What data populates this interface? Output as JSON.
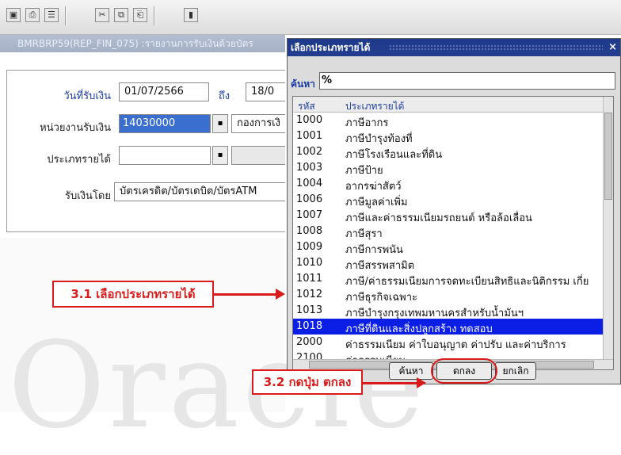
{
  "toolbar": {
    "icons": [
      "window-icon",
      "print-icon",
      "preview-icon",
      "cut-icon",
      "copy-icon",
      "paste-icon",
      "help-icon"
    ]
  },
  "bgwindow": {
    "title": "BMRBRP59(REP_FIN_075) :รายงานการรับเงินด้วยบัตร"
  },
  "form": {
    "date_label": "วันที่รับเงิน",
    "date_from": "01/07/2566",
    "to_label": "ถึง",
    "date_to": "18/0",
    "unit_label": "หน่วยงานรับเงิน",
    "unit_code": "14030000",
    "unit_name": "กองการเงิ",
    "income_label": "ประเภทรายได้",
    "income_value": "",
    "method_label": "รับเงินโดย",
    "method_value": "บัตรเครดิต/บัตรเดบิต/บัตรATM"
  },
  "watermark": "Oracle",
  "dialog": {
    "title": "เลือกประเภทรายได้",
    "close": "×",
    "search_label": "ค้นหา",
    "search_value": "%",
    "col_code": "รหัส",
    "col_name": "ประเภทรายได้",
    "rows": [
      {
        "code": "1000",
        "name": "ภาษีอากร"
      },
      {
        "code": "1001",
        "name": "ภาษีบำรุงท้องที่"
      },
      {
        "code": "1002",
        "name": "ภาษีโรงเรือนและที่ดิน"
      },
      {
        "code": "1003",
        "name": "ภาษีป้าย"
      },
      {
        "code": "1004",
        "name": "อากรฆ่าสัตว์"
      },
      {
        "code": "1006",
        "name": "ภาษีมูลค่าเพิ่ม"
      },
      {
        "code": "1007",
        "name": "ภาษีและค่าธรรมเนียมรถยนต์ หรือล้อเลื่อน"
      },
      {
        "code": "1008",
        "name": "ภาษีสุรา"
      },
      {
        "code": "1009",
        "name": "ภาษีการพนัน"
      },
      {
        "code": "1010",
        "name": "ภาษีสรรพสามิต"
      },
      {
        "code": "1011",
        "name": "ภาษี/ค่าธรรมเนียมการจดทะเบียนสิทธิและนิติกรรม เกี่ย"
      },
      {
        "code": "1012",
        "name": "ภาษีธุรกิจเฉพาะ"
      },
      {
        "code": "1013",
        "name": "ภาษีบำรุงกรุงเทพมหานครสำหรับน้ำมันฯ"
      },
      {
        "code": "1018",
        "name": "ภาษีที่ดินและสิ่งปลูกสร้าง ทดสอบ"
      },
      {
        "code": "2000",
        "name": "ค่าธรรมเนียม ค่าใบอนุญาต ค่าปรับ และค่าบริการ"
      },
      {
        "code": "2100",
        "name": "ค่าธรรมเนียม"
      }
    ],
    "selected_index": 13,
    "btn_find": "ค้นหา",
    "btn_ok": "ตกลง",
    "btn_cancel": "ยกเลิก"
  },
  "annotations": {
    "step1": "3.1 เลือกประเภทรายได้",
    "step2": "3.2 กดปุ่ม ตกลง"
  },
  "colors": {
    "highlight": "#0a1ee6",
    "annotation": "#d91b1b",
    "title_bar": "#1e3a8a"
  }
}
